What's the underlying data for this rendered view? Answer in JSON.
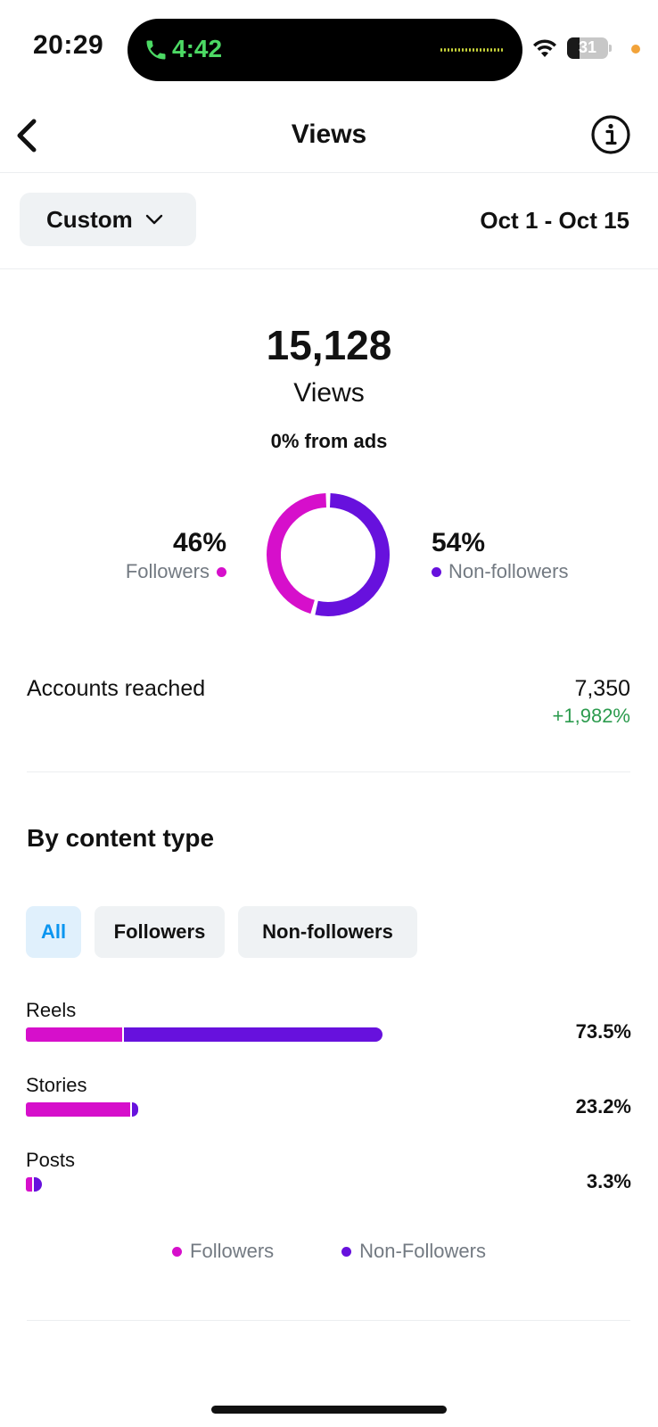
{
  "status_bar": {
    "time": "20:29",
    "call_timer": "4:42",
    "battery_level": "31",
    "battery_fraction": 0.31,
    "icons": [
      "phone-icon",
      "waveform-icon",
      "wifi-icon",
      "battery-icon",
      "privacy-dot"
    ]
  },
  "nav": {
    "title": "Views",
    "back_icon": "chevron-left-icon",
    "info_icon": "info-icon"
  },
  "filter": {
    "period": "Custom",
    "date_range": "Oct 1 - Oct 15"
  },
  "summary": {
    "total": "15,128",
    "total_label": "Views",
    "ads_text": "0% from ads",
    "followers_pct": "46%",
    "followers_label": "Followers",
    "followers_fraction": 0.46,
    "non_followers_pct": "54%",
    "non_followers_label": "Non-followers",
    "non_followers_fraction": 0.54
  },
  "reach": {
    "label": "Accounts reached",
    "value": "7,350",
    "change": "+1,982%"
  },
  "content_type": {
    "title": "By content type",
    "tabs": [
      {
        "label": "All",
        "active": true
      },
      {
        "label": "Followers",
        "active": false
      },
      {
        "label": "Non-followers",
        "active": false
      }
    ],
    "rows": [
      {
        "label": "Reels",
        "percent": "73.5%",
        "value": 73.5,
        "followers_share": 0.27
      },
      {
        "label": "Stories",
        "percent": "23.2%",
        "value": 23.2,
        "followers_share": 0.93
      },
      {
        "label": "Posts",
        "percent": "3.3%",
        "value": 3.3,
        "followers_share": 0.4
      }
    ],
    "legend": {
      "followers": "Followers",
      "non_followers": "Non-Followers"
    }
  },
  "colors": {
    "followers": "#d60fcb",
    "non_followers": "#6711dd",
    "positive": "#2c9b4e",
    "active_tab_text": "#0a95f0",
    "active_tab_bg": "#e0f0fc"
  }
}
